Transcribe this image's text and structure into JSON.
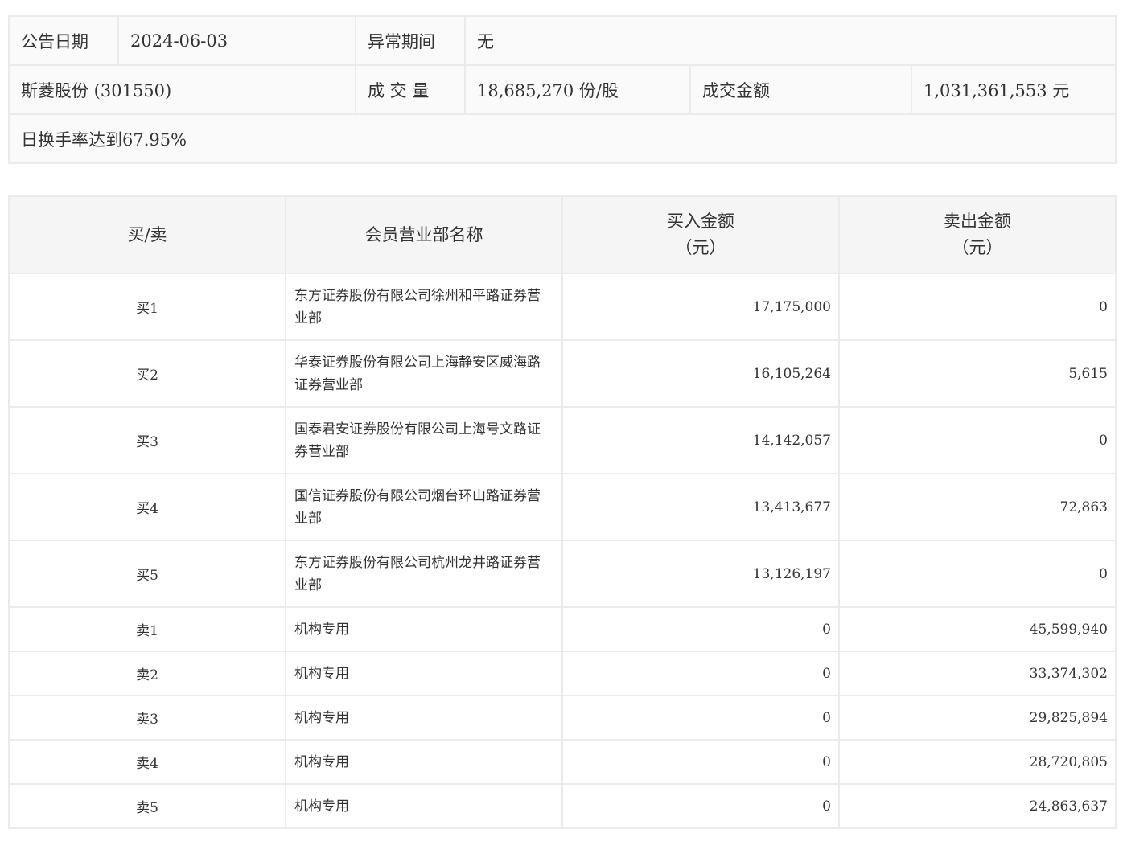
{
  "info": {
    "date_label": "公告日期",
    "date_value": "2024-06-03",
    "abnormal_label": "异常期间",
    "abnormal_value": "无",
    "stock": "斯菱股份 (301550)",
    "volume_label": "成 交 量",
    "volume_value": "18,685,270 份/股",
    "amount_label": "成交金额",
    "amount_value": "1,031,361,553 元",
    "reason": "日换手率达到67.95%"
  },
  "table": {
    "headers": [
      "买/卖",
      "会员营业部名称",
      "买入金额",
      "（元）",
      "卖出金额",
      "（元）"
    ],
    "rows": [
      {
        "side": "买1",
        "name": "东方证券股份有限公司徐州和平路证券营业部",
        "buy": "17,175,000",
        "sell": "0"
      },
      {
        "side": "买2",
        "name": "华泰证券股份有限公司上海静安区威海路证券营业部",
        "buy": "16,105,264",
        "sell": "5,615"
      },
      {
        "side": "买3",
        "name": "国泰君安证券股份有限公司上海号文路证券营业部",
        "buy": "14,142,057",
        "sell": "0"
      },
      {
        "side": "买4",
        "name": "国信证券股份有限公司烟台环山路证券营业部",
        "buy": "13,413,677",
        "sell": "72,863"
      },
      {
        "side": "买5",
        "name": "东方证券股份有限公司杭州龙井路证券营业部",
        "buy": "13,126,197",
        "sell": "0"
      },
      {
        "side": "卖1",
        "name": "机构专用",
        "buy": "0",
        "sell": "45,599,940"
      },
      {
        "side": "卖2",
        "name": "机构专用",
        "buy": "0",
        "sell": "33,374,302"
      },
      {
        "side": "卖3",
        "name": "机构专用",
        "buy": "0",
        "sell": "29,825,894"
      },
      {
        "side": "卖4",
        "name": "机构专用",
        "buy": "0",
        "sell": "28,720,805"
      },
      {
        "side": "卖5",
        "name": "机构专用",
        "buy": "0",
        "sell": "24,863,637"
      }
    ]
  }
}
